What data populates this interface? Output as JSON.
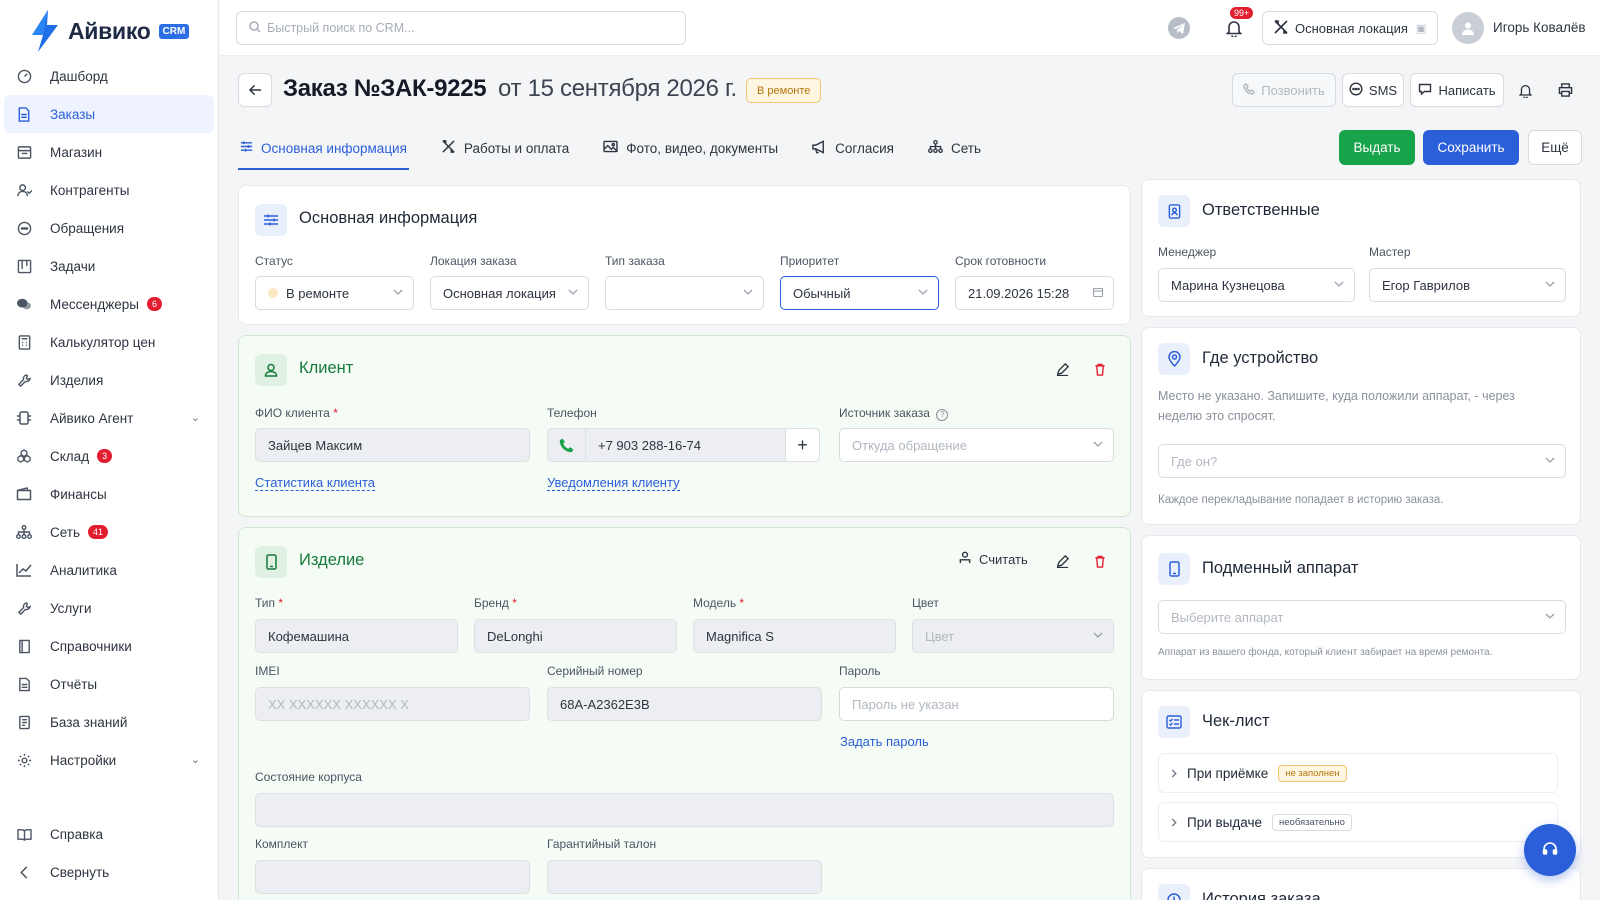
{
  "brand": {
    "name": "Айвико",
    "badge": "CRM"
  },
  "nav": {
    "items": [
      {
        "label": "Дашборд",
        "icon": "dashboard-icon"
      },
      {
        "label": "Заказы",
        "icon": "orders-icon",
        "active": true
      },
      {
        "label": "Магазин",
        "icon": "store-icon"
      },
      {
        "label": "Контрагенты",
        "icon": "contacts-icon"
      },
      {
        "label": "Обращения",
        "icon": "chat-icon"
      },
      {
        "label": "Задачи",
        "icon": "kanban-icon"
      },
      {
        "label": "Мессенджеры",
        "icon": "messengers-icon",
        "badge": "6"
      },
      {
        "label": "Калькулятор цен",
        "icon": "calculator-icon"
      },
      {
        "label": "Изделия",
        "icon": "wrench-icon"
      },
      {
        "label": "Айвико Агент",
        "icon": "agent-icon",
        "chevron": true
      },
      {
        "label": "Склад",
        "icon": "warehouse-icon",
        "badge": "3"
      },
      {
        "label": "Финансы",
        "icon": "wallet-icon"
      },
      {
        "label": "Сеть",
        "icon": "network-icon",
        "badge": "41"
      },
      {
        "label": "Аналитика",
        "icon": "analytics-icon"
      },
      {
        "label": "Услуги",
        "icon": "services-icon"
      },
      {
        "label": "Справочники",
        "icon": "book-icon"
      },
      {
        "label": "Отчёты",
        "icon": "report-icon"
      },
      {
        "label": "База знаний",
        "icon": "knowledge-icon"
      },
      {
        "label": "Настройки",
        "icon": "gear-icon",
        "chevron": true
      }
    ],
    "bottom": [
      {
        "label": "Справка",
        "icon": "help-book-icon"
      },
      {
        "label": "Свернуть",
        "icon": "collapse-icon"
      }
    ]
  },
  "topbar": {
    "search_placeholder": "Быстрый поиск по CRM...",
    "notif_badge": "99+",
    "location": "Основная локация",
    "user": "Игорь Ковалёв"
  },
  "header": {
    "title": "Заказ №ЗАК-9225",
    "date": "от 15 сентября 2026 г.",
    "status": "В ремонте",
    "call": "Позвонить",
    "sms": "SMS",
    "write": "Написать"
  },
  "tabs": [
    {
      "label": "Основная информация",
      "icon": "sliders-icon",
      "active": true
    },
    {
      "label": "Работы и оплата",
      "icon": "tools-icon"
    },
    {
      "label": "Фото, видео, документы",
      "icon": "image-icon"
    },
    {
      "label": "Согласия",
      "icon": "megaphone-icon"
    },
    {
      "label": "Сеть",
      "icon": "network-icon"
    }
  ],
  "actions": {
    "issue": "Выдать",
    "save": "Сохранить",
    "more": "Ещё"
  },
  "main_info": {
    "title": "Основная информация",
    "status_label": "Статус",
    "status_value": "В ремонте",
    "location_label": "Локация заказа",
    "location_value": "Основная локация",
    "type_label": "Тип заказа",
    "type_value": "",
    "priority_label": "Приоритет",
    "priority_value": "Обычный",
    "deadline_label": "Срок готовности",
    "deadline_value": "21.09.2026 15:28"
  },
  "client": {
    "title": "Клиент",
    "name_label": "ФИО клиента",
    "name_value": "Зайцев Максим",
    "phone_label": "Телефон",
    "phone_value": "+7 903 288-16-74",
    "source_label": "Источник заказа",
    "source_placeholder": "Откуда обращение",
    "stats_link": "Статистика клиента",
    "notify_link": "Уведомления клиенту"
  },
  "device": {
    "title": "Изделие",
    "read_label": "Считать",
    "type_label": "Тип",
    "type_value": "Кофемашина",
    "brand_label": "Бренд",
    "brand_value": "DeLonghi",
    "model_label": "Модель",
    "model_value": "Magnifica S",
    "color_label": "Цвет",
    "color_placeholder": "Цвет",
    "imei_label": "IMEI",
    "imei_placeholder": "XX XXXXXX XXXXXX X",
    "serial_label": "Серийный номер",
    "serial_value": "68A-A2362E3B",
    "password_label": "Пароль",
    "password_placeholder": "Пароль не указан",
    "set_password": "Задать пароль",
    "body_label": "Состояние корпуса",
    "kit_label": "Комплект",
    "warranty_label": "Гарантийный талон"
  },
  "responsible": {
    "title": "Ответственные",
    "manager_label": "Менеджер",
    "manager_value": "Марина Кузнецова",
    "master_label": "Мастер",
    "master_value": "Егор Гаврилов"
  },
  "where": {
    "title": "Где устройство",
    "hint": "Место не указано. Запишите, куда положили аппарат, - через неделю это спросят.",
    "placeholder": "Где он?",
    "note": "Каждое перекладывание попадает в историю заказа."
  },
  "substitute": {
    "title": "Подменный аппарат",
    "placeholder": "Выберите аппарат",
    "note": "Аппарат из вашего фонда, который клиент забирает на время ремонта."
  },
  "checklist": {
    "title": "Чек-лист",
    "rows": [
      {
        "label": "При приёмке",
        "tag": "не заполнен"
      },
      {
        "label": "При выдаче",
        "tag": "необязательно"
      }
    ]
  },
  "history": {
    "title": "История заказа"
  },
  "colors": {
    "accent": "#2b5fd9",
    "success": "#16a34a",
    "danger": "#e11d2e",
    "warning": "#b5760e"
  }
}
